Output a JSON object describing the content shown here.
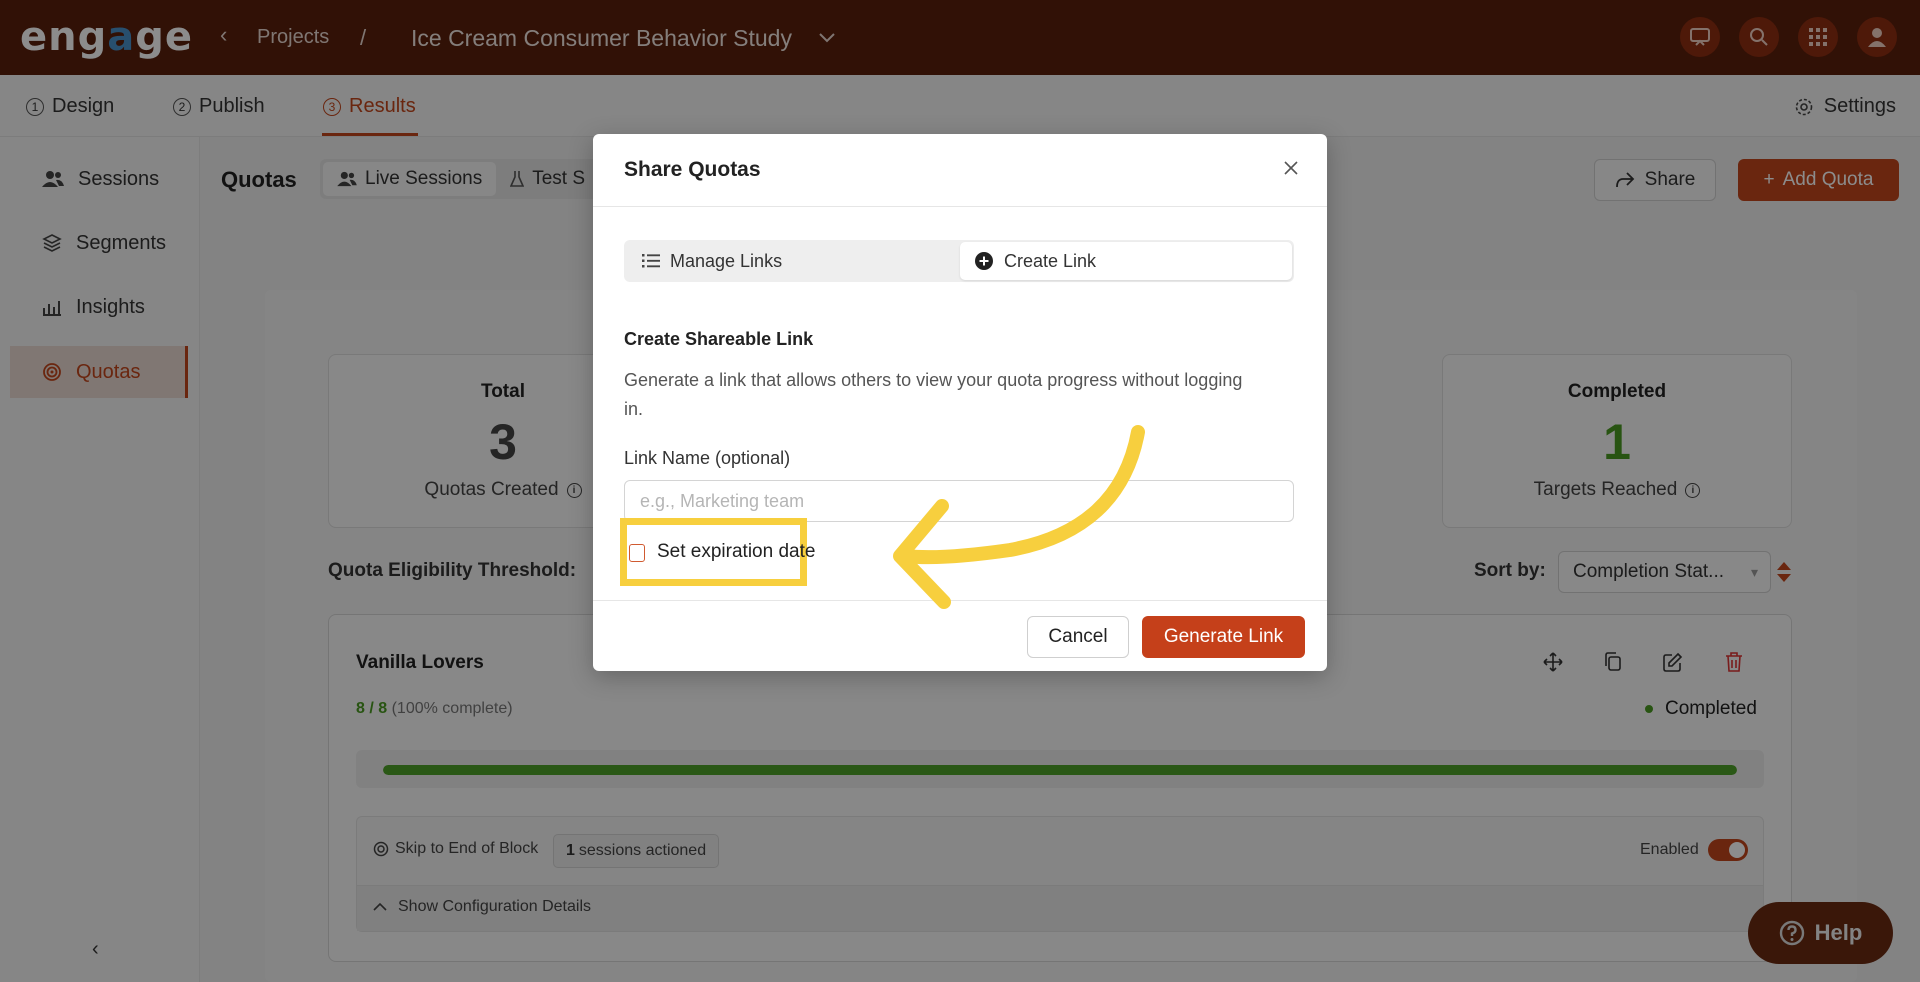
{
  "header": {
    "logo": "engage",
    "breadcrumb_projects": "Projects",
    "breadcrumb_separator": "/",
    "project_title": "Ice Cream Consumer Behavior Study",
    "icons": [
      "presentation-icon",
      "search-icon",
      "apps-grid-icon",
      "user-avatar-icon"
    ]
  },
  "steps": [
    {
      "number": "1",
      "label": "Design"
    },
    {
      "number": "2",
      "label": "Publish"
    },
    {
      "number": "3",
      "label": "Results"
    }
  ],
  "settings_label": "Settings",
  "sidebar": {
    "items": [
      {
        "label": "Sessions",
        "icon": "users-icon"
      },
      {
        "label": "Segments",
        "icon": "layers-icon"
      },
      {
        "label": "Insights",
        "icon": "chart-icon"
      },
      {
        "label": "Quotas",
        "icon": "target-icon"
      }
    ],
    "active": "Quotas"
  },
  "quotas_header": {
    "title": "Quotas",
    "live_sessions": "Live Sessions",
    "test_sessions": "Test S",
    "share": "Share",
    "add_quota": "Add Quota"
  },
  "stats": {
    "total": {
      "label": "Total",
      "value": "3",
      "sub": "Quotas Created"
    },
    "completed": {
      "label": "Completed",
      "value": "1",
      "sub": "Targets Reached"
    }
  },
  "threshold_label": "Quota Eligibility Threshold:",
  "sort": {
    "label": "Sort by:",
    "value": "Completion Stat..."
  },
  "quota_card": {
    "title": "Vanilla Lovers",
    "progress_count": "8 / 8",
    "progress_pct_text": "(100% complete)",
    "progress_fraction": 1.0,
    "status": "Completed",
    "action": "Skip to End of Block",
    "sessions_count": "1",
    "sessions_text": "sessions actioned",
    "enabled_label": "Enabled",
    "config_toggle": "Show Configuration Details"
  },
  "help_label": "Help",
  "modal": {
    "title": "Share Quotas",
    "tab_manage": "Manage Links",
    "tab_create": "Create Link",
    "heading": "Create Shareable Link",
    "description": "Generate a link that allows others to view your quota progress without logging in.",
    "link_name_label": "Link Name (optional)",
    "link_name_placeholder": "e.g., Marketing team",
    "expiration_label": "Set expiration date",
    "cancel": "Cancel",
    "generate": "Generate Link"
  },
  "colors": {
    "brand": "#c2461c",
    "topbar": "#5a1f0c",
    "success": "#4a9a22",
    "highlight": "#f7cf3e"
  }
}
